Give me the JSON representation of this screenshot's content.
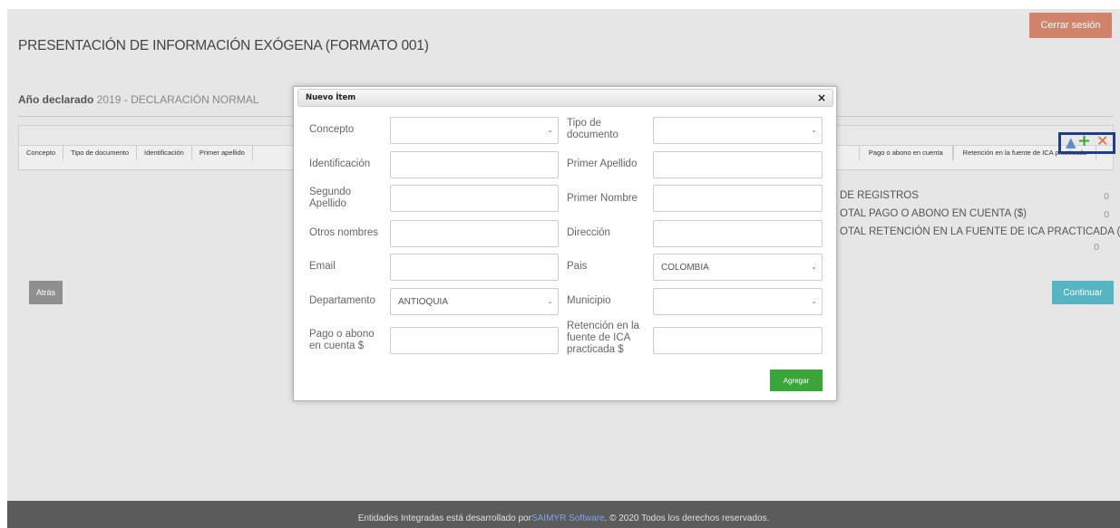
{
  "header": {
    "logout_label": "Cerrar sesión",
    "title": "PRESENTACIÓN DE INFORMACIÓN EXÓGENA (FORMATO 001)",
    "year_label": "Año declarado",
    "year_value": "2019 - DECLARACIÓN NORMAL"
  },
  "grid": {
    "columns_left": [
      "Concepto",
      "Tipo de documento",
      "Identificación",
      "Primer apellido"
    ],
    "columns_right": [
      "Pago o abono en cuenta",
      "Retención en la fuente de ICA practicada"
    ],
    "colors": {
      "toolbar_highlight": "#1f3d8a",
      "add": "#3aa63a",
      "delete": "#e0684e",
      "up": "#5b8fc8"
    }
  },
  "summary": {
    "records_label": "DE REGISTROS",
    "records_value": "0",
    "total_payment_label": "OTAL PAGO O ABONO EN CUENTA ($)",
    "total_payment_value": "0",
    "total_retention_label": "OTAL RETENCIÓN EN LA FUENTE DE ICA PRACTICADA ($)",
    "total_retention_value": "0"
  },
  "nav": {
    "back_label": "Atrás",
    "continue_label": "Continuar"
  },
  "modal": {
    "title": "Nuevo Ítem",
    "close_symbol": "×",
    "concepto_label": "Concepto",
    "concepto_value": "",
    "tipo_doc_label": "Tipo de documento",
    "tipo_doc_value": "",
    "identificacion_label": "Identificación",
    "primer_apellido_label": "Primer Apellido",
    "segundo_apellido_label": "Segundo Apellido",
    "primer_nombre_label": "Primer Nombre",
    "otros_nombres_label": "Otros nombres",
    "direccion_label": "Dirección",
    "email_label": "Email",
    "pais_label": "Pais",
    "pais_value": "COLOMBIA",
    "departamento_label": "Departamento",
    "departamento_value": "ANTIOQUIA",
    "municipio_label": "Municipio",
    "municipio_value": "",
    "pago_label": "Pago o abono en cuenta $",
    "retencion_label": "Retención en la fuente de ICA practicada $",
    "add_label": "Agregar"
  },
  "footer": {
    "text_before": "Entidades Integradas está desarrollado por ",
    "link": "SAIMYR Software",
    "text_after": ". © 2020 Todos los derechos reservados."
  }
}
